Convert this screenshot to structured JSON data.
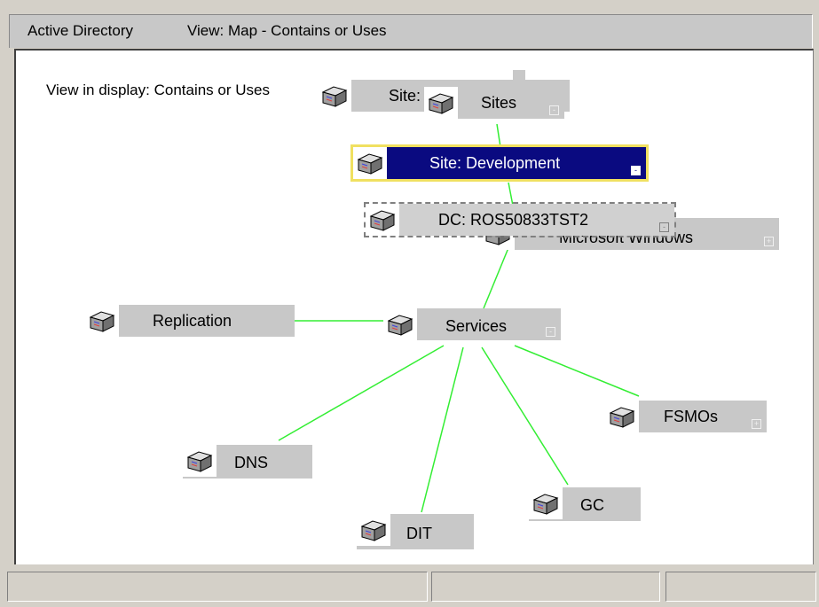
{
  "toolbar": {
    "app_label": "Active Directory",
    "view_label": "View: Map - Contains or Uses"
  },
  "canvas": {
    "hint": "View in display: Contains or Uses"
  },
  "nodes": {
    "site_back": {
      "label": "Site: ...",
      "toggle": ""
    },
    "sites": {
      "label": "Sites",
      "toggle": "-"
    },
    "site_dev": {
      "label": "Site: Development",
      "toggle": "-"
    },
    "dc": {
      "label": "DC: ROS50833TST2",
      "toggle": "-"
    },
    "mswindows": {
      "label": "Microsoft Windows",
      "toggle": "+"
    },
    "replication": {
      "label": "Replication",
      "toggle": ""
    },
    "services": {
      "label": "Services",
      "toggle": "-"
    },
    "fsmos": {
      "label": "FSMOs",
      "toggle": "+"
    },
    "dns": {
      "label": "DNS",
      "toggle": ""
    },
    "gc": {
      "label": "GC",
      "toggle": ""
    },
    "dit": {
      "label": "DIT",
      "toggle": ""
    }
  },
  "icon_name": "package-icon",
  "link_color": "#33ee33"
}
